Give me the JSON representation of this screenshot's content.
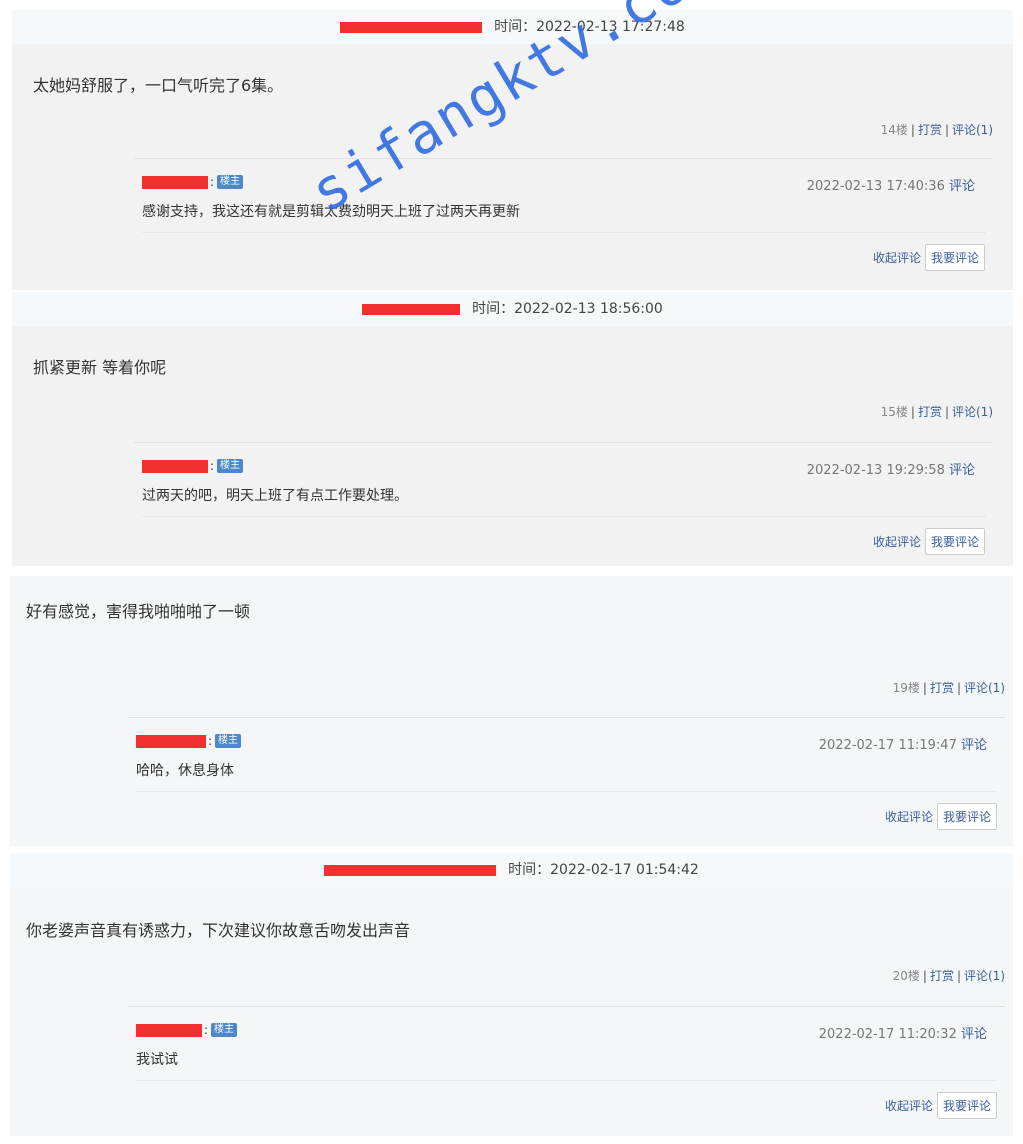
{
  "time_label": "时间：",
  "collapse_label": "收起评论",
  "reply_button_label": "我要评论",
  "reward_label": "打赏",
  "owner_badge": "楼主",
  "watermark": "sifangktv.com",
  "comments": [
    {
      "header_time": "2022-02-13 17:27:48",
      "text": "太她妈舒服了，一口气听完了6集。",
      "floor": "14楼",
      "comment_count": "评论(1)",
      "reply": {
        "time": "2022-02-13 17:40:36",
        "action": "评论",
        "text": "感谢支持，我这还有就是剪辑太费劲明天上班了过两天再更新"
      }
    },
    {
      "header_time": "2022-02-13 18:56:00",
      "text": "抓紧更新 等着你呢",
      "floor": "15楼",
      "comment_count": "评论(1)",
      "reply": {
        "time": "2022-02-13 19:29:58",
        "action": "评论",
        "text": "过两天的吧，明天上班了有点工作要处理。"
      }
    },
    {
      "header_time": "",
      "text": "好有感觉，害得我啪啪啪了一顿",
      "floor": "19楼",
      "comment_count": "评论(1)",
      "reply": {
        "time": "2022-02-17 11:19:47",
        "action": "评论",
        "text": "哈哈，休息身体"
      }
    },
    {
      "header_time": "2022-02-17 01:54:42",
      "text": "你老婆声音真有诱惑力，下次建议你故意舌吻发出声音",
      "floor": "20楼",
      "comment_count": "评论(1)",
      "reply": {
        "time": "2022-02-17 11:20:32",
        "action": "评论",
        "text": "我试试"
      }
    }
  ]
}
